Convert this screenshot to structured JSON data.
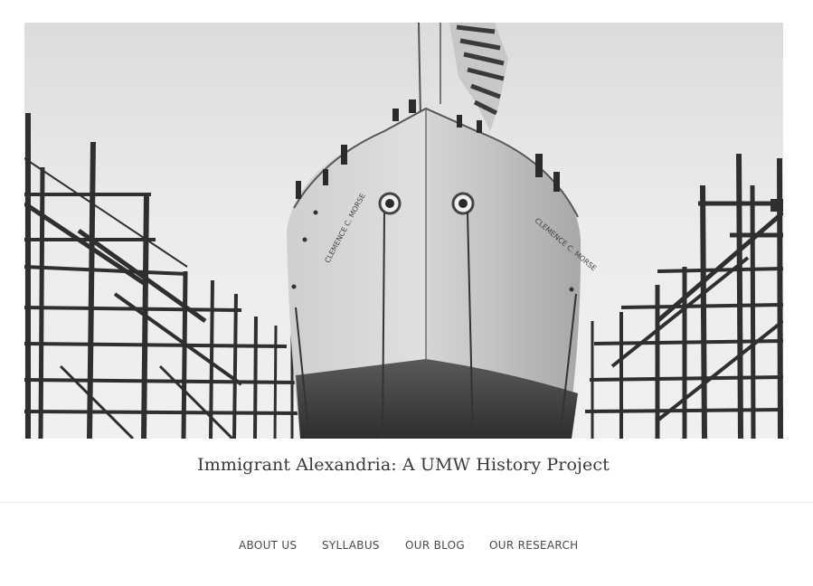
{
  "header": {
    "image_alt": "Ship Clemence C. Morse on the building ways surrounded by wooden scaffolding",
    "hull_name_left": "CLEMENCE C. MORSE",
    "hull_name_right": "CLEMENCE C. MORSE"
  },
  "site": {
    "title": "Immigrant Alexandria: A UMW History Project"
  },
  "nav": {
    "items": [
      {
        "label": "ABOUT US"
      },
      {
        "label": "SYLLABUS"
      },
      {
        "label": "OUR BLOG"
      },
      {
        "label": "OUR RESEARCH"
      }
    ]
  },
  "colors": {
    "title_text": "#3a3a3a",
    "nav_text": "#4a4a4a",
    "divider": "#ececec",
    "photo_sky": "#e8e8e8",
    "photo_hull": "#cfcfcf",
    "photo_hull_dark": "#3a3a3a"
  }
}
